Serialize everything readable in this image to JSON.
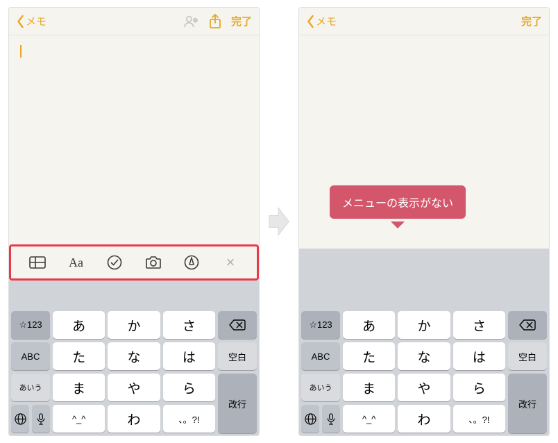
{
  "header": {
    "back_label": "メモ",
    "done_label": "完了"
  },
  "callout_text": "メニューの表示がない",
  "toolbar": {
    "aa_label": "Aa",
    "close_label": "×"
  },
  "keyboard": {
    "side_col1": [
      "☆123",
      "ABC",
      "あいう"
    ],
    "main_rows": [
      [
        "あ",
        "か",
        "さ"
      ],
      [
        "た",
        "な",
        "は"
      ],
      [
        "ま",
        "や",
        "ら"
      ],
      [
        "^_^",
        "わ",
        "、。?!"
      ]
    ],
    "side_col2_top": "⌫",
    "side_col2_space": "空白",
    "side_col2_return": "改行"
  }
}
